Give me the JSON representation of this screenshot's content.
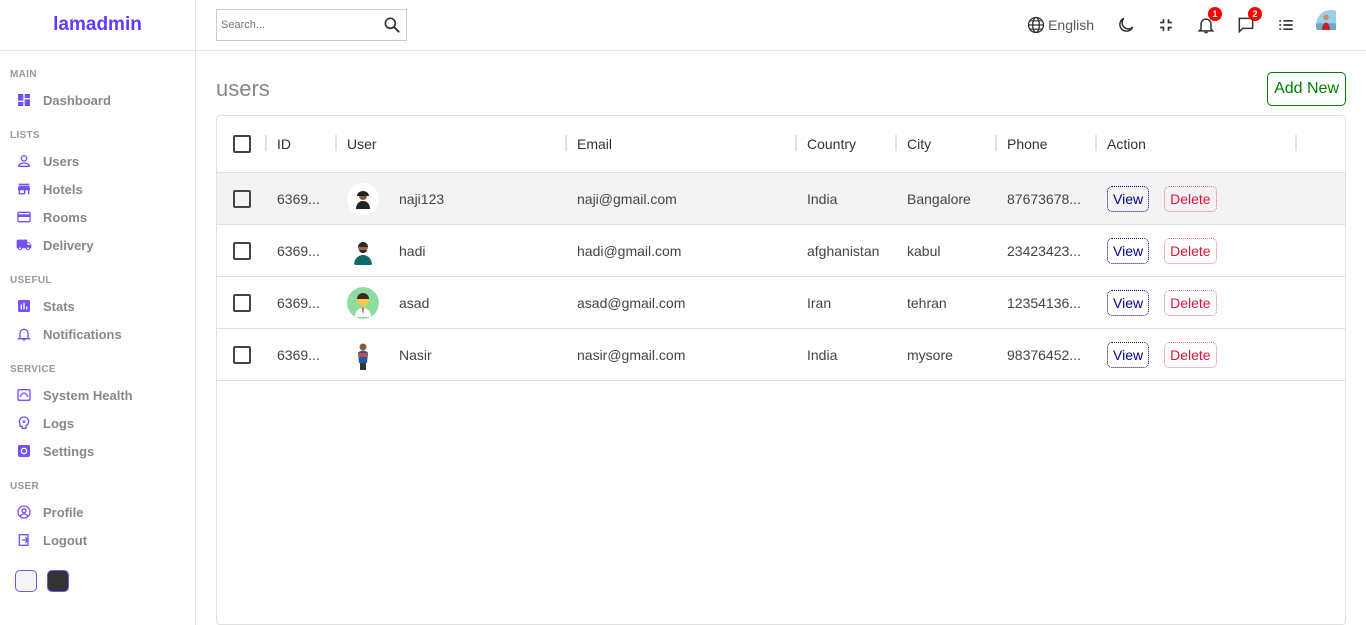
{
  "brand": {
    "logo": "lamadmin"
  },
  "sidebar": {
    "sections": [
      {
        "title": "MAIN",
        "items": [
          {
            "label": "Dashboard",
            "icon": "dashboard-icon"
          }
        ]
      },
      {
        "title": "LISTS",
        "items": [
          {
            "label": "Users",
            "icon": "person-icon"
          },
          {
            "label": "Hotels",
            "icon": "store-icon"
          },
          {
            "label": "Rooms",
            "icon": "credit-card-icon"
          },
          {
            "label": "Delivery",
            "icon": "truck-icon"
          }
        ]
      },
      {
        "title": "USEFUL",
        "items": [
          {
            "label": "Stats",
            "icon": "bar-chart-icon"
          },
          {
            "label": "Notifications",
            "icon": "bell-icon"
          }
        ]
      },
      {
        "title": "SERVICE",
        "items": [
          {
            "label": "System Health",
            "icon": "health-icon"
          },
          {
            "label": "Logs",
            "icon": "psychology-icon"
          },
          {
            "label": "Settings",
            "icon": "settings-icon"
          }
        ]
      },
      {
        "title": "USER",
        "items": [
          {
            "label": "Profile",
            "icon": "account-circle-icon"
          },
          {
            "label": "Logout",
            "icon": "logout-icon"
          }
        ]
      }
    ]
  },
  "navbar": {
    "search_placeholder": "Search...",
    "language": "English",
    "notifications_count": "1",
    "messages_count": "2"
  },
  "page": {
    "title": "users",
    "add_label": "Add New"
  },
  "table": {
    "columns": [
      "ID",
      "User",
      "Email",
      "Country",
      "City",
      "Phone",
      "Action"
    ],
    "rows": [
      {
        "id": "6369...",
        "user": "naji123",
        "email": "naji@gmail.com",
        "country": "India",
        "city": "Bangalore",
        "phone": "87673678...",
        "view": "View",
        "delete": "Delete"
      },
      {
        "id": "6369...",
        "user": "hadi",
        "email": "hadi@gmail.com",
        "country": "afghanistan",
        "city": "kabul",
        "phone": "23423423...",
        "view": "View",
        "delete": "Delete"
      },
      {
        "id": "6369...",
        "user": "asad",
        "email": "asad@gmail.com",
        "country": "Iran",
        "city": "tehran",
        "phone": "12354136...",
        "view": "View",
        "delete": "Delete"
      },
      {
        "id": "6369...",
        "user": "Nasir",
        "email": "nasir@gmail.com",
        "country": "India",
        "city": "mysore",
        "phone": "98376452...",
        "view": "View",
        "delete": "Delete"
      }
    ]
  },
  "colors": {
    "accent": "#6439ff",
    "icon": "#7451f8",
    "add": "#008000",
    "view": "#00008b",
    "delete": "#dc143c"
  }
}
